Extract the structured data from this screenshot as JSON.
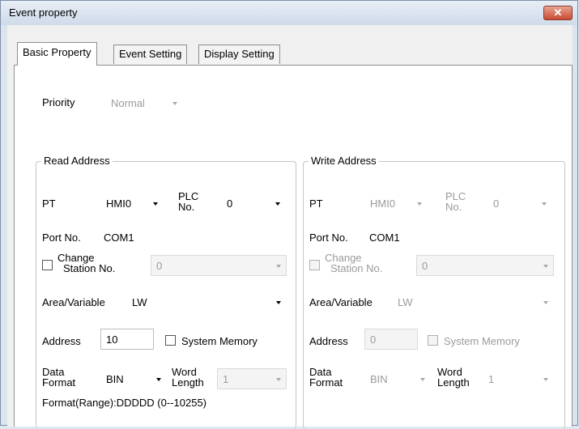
{
  "window": {
    "title": "Event property",
    "close_glyph": "✕"
  },
  "tabs": [
    {
      "label": "Basic Property",
      "active": true
    },
    {
      "label": "Event Setting",
      "active": false
    },
    {
      "label": "Display Setting",
      "active": false
    }
  ],
  "priority": {
    "label": "Priority",
    "value": "Normal"
  },
  "read": {
    "title": "Read Address",
    "pt_label": "PT",
    "pt_value": "HMI0",
    "plc_label_1": "PLC",
    "plc_label_2": "No.",
    "plc_value": "0",
    "port_label": "Port No.",
    "port_value": "COM1",
    "change_label_1": "Change",
    "change_label_2": "Station No.",
    "station_value": "0",
    "area_label": "Area/Variable",
    "area_value": "LW",
    "address_label": "Address",
    "address_value": "10",
    "sysmem_label": "System Memory",
    "format_label_1": "Data",
    "format_label_2": "Format",
    "format_value": "BIN",
    "wordlen_label_1": "Word",
    "wordlen_label_2": "Length",
    "wordlen_value": "1",
    "range_text": "Format(Range):DDDDD (0--10255)"
  },
  "write": {
    "title": "Write Address",
    "pt_label": "PT",
    "pt_value": "HMI0",
    "plc_label_1": "PLC",
    "plc_label_2": "No.",
    "plc_value": "0",
    "port_label": "Port No.",
    "port_value": "COM1",
    "change_label_1": "Change",
    "change_label_2": "Station No.",
    "station_value": "0",
    "area_label": "Area/Variable",
    "area_value": "LW",
    "address_label": "Address",
    "address_value": "0",
    "sysmem_label": "System Memory",
    "format_label_1": "Data",
    "format_label_2": "Format",
    "format_value": "BIN",
    "wordlen_label_1": "Word",
    "wordlen_label_2": "Length",
    "wordlen_value": "1"
  }
}
